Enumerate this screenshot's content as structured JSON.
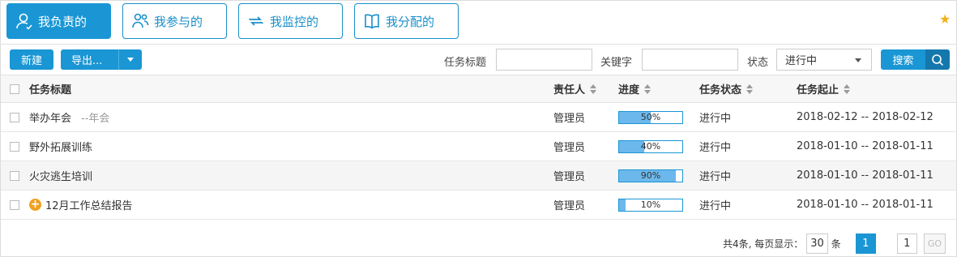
{
  "tabs": [
    {
      "label": "我负责的",
      "icon": "user-icon",
      "active": true
    },
    {
      "label": "我参与的",
      "icon": "team-icon",
      "active": false
    },
    {
      "label": "我监控的",
      "icon": "sync-icon",
      "active": false
    },
    {
      "label": "我分配的",
      "icon": "book-icon",
      "active": false
    }
  ],
  "star_icon": "star-icon",
  "toolbar": {
    "new_label": "新建",
    "export_label": "导出...",
    "title_label": "任务标题",
    "title_value": "",
    "keyword_label": "关键字",
    "keyword_value": "",
    "status_label": "状态",
    "status_value": "进行中",
    "search_label": "搜索"
  },
  "table": {
    "headers": {
      "title": "任务标题",
      "owner": "责任人",
      "progress": "进度",
      "status": "任务状态",
      "period": "任务起止"
    },
    "rows": [
      {
        "title": "举办年会",
        "subtitle": "--年会",
        "owner": "管理员",
        "progress": 50,
        "progress_text": "50%",
        "status": "进行中",
        "period": "2018-02-12 -- 2018-02-12"
      },
      {
        "title": "野外拓展训练",
        "subtitle": "",
        "owner": "管理员",
        "progress": 40,
        "progress_text": "40%",
        "status": "进行中",
        "period": "2018-01-10 -- 2018-01-11"
      },
      {
        "title": "火灾逃生培训",
        "subtitle": "",
        "owner": "管理员",
        "progress": 90,
        "progress_text": "90%",
        "status": "进行中",
        "period": "2018-01-10 -- 2018-01-11"
      },
      {
        "title": "12月工作总结报告",
        "subtitle": "",
        "owner": "管理员",
        "progress": 10,
        "progress_text": "10%",
        "status": "进行中",
        "period": "2018-01-10 -- 2018-01-11",
        "has_add_icon": true
      }
    ]
  },
  "pager": {
    "summary": "共4条, 每页显示：",
    "page_size": "30",
    "unit": "条",
    "current_page": "1",
    "jump_value": "1",
    "go_label": "GO"
  },
  "colors": {
    "accent": "#1a96d4",
    "accent_dark": "#1478ad",
    "progress_fill": "#6cb8ec",
    "star": "#f2b01e",
    "add_icon": "#f0a020"
  }
}
